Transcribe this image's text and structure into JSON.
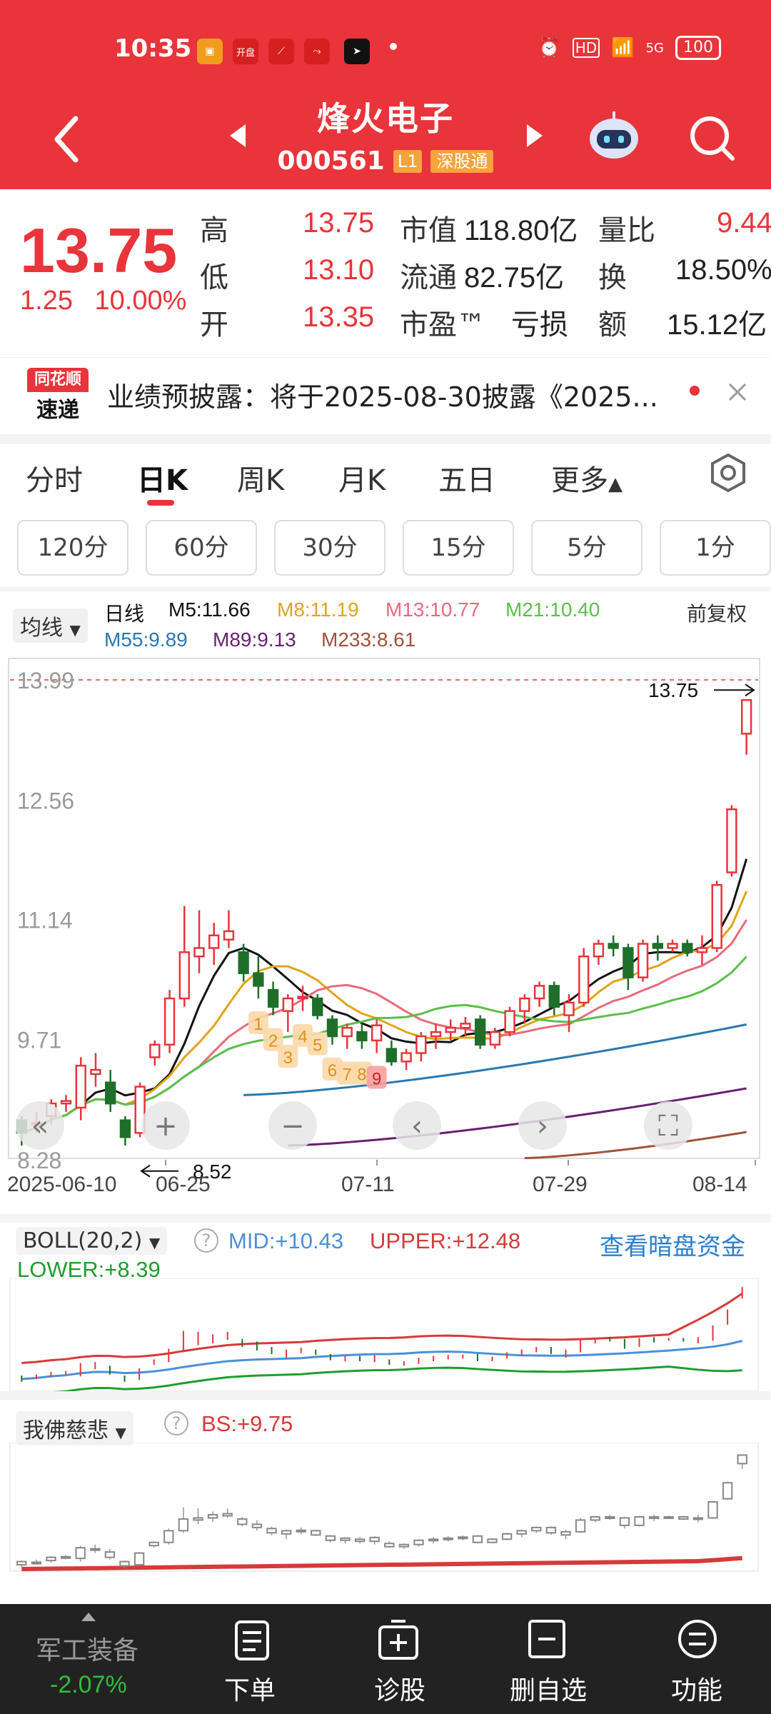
{
  "status_bar": {
    "time": "10:35",
    "net": "HD",
    "signal": "5G",
    "battery": "100"
  },
  "status_apps": [
    "开盘"
  ],
  "header": {
    "title": "烽火电子",
    "code": "000561",
    "level_tag": "L1",
    "market_tag": "深股通"
  },
  "quote": {
    "price": "13.75",
    "change": "1.25",
    "change_pct": "10.00%",
    "rows": [
      {
        "l1": "高",
        "v1": "13.75",
        "l2": "市值",
        "v2": "118.80亿",
        "l3": "量比",
        "v3": "9.44"
      },
      {
        "l1": "低",
        "v1": "13.10",
        "l2": "流通",
        "v2": "82.75亿",
        "l3": "换",
        "v3": "18.50%"
      },
      {
        "l1": "开",
        "v1": "13.35",
        "l2": "市盈™",
        "v2": "亏损",
        "l3": "额",
        "v3": "15.12亿"
      }
    ]
  },
  "news": {
    "logo_top": "同花顺",
    "logo_bottom": "速递",
    "text": "业绩预披露：将于2025-08-30披露《2025..."
  },
  "chart_tabs": [
    "分时",
    "日K",
    "周K",
    "月K",
    "五日",
    "更多"
  ],
  "active_tab": "日K",
  "minute_buttons": [
    "120分",
    "60分",
    "30分",
    "15分",
    "5分",
    "1分"
  ],
  "ma_legend": {
    "dropdown": "均线",
    "period": "日线",
    "right": "前复权",
    "items": [
      {
        "label": "M5:11.66",
        "color": "#111111"
      },
      {
        "label": "M8:11.19",
        "color": "#E0A41A"
      },
      {
        "label": "M13:10.77",
        "color": "#E96A7C"
      },
      {
        "label": "M21:10.40",
        "color": "#5BBF4A"
      },
      {
        "label": "M55:9.89",
        "color": "#2A78B0"
      },
      {
        "label": "M89:9.13",
        "color": "#6A1F6E"
      },
      {
        "label": "M233:8.61",
        "color": "#A0523C"
      }
    ]
  },
  "main_chart": {
    "y_ticks": [
      "13.99",
      "12.56",
      "11.14",
      "9.71",
      "8.28"
    ],
    "x_ticks": [
      "2025-06-10",
      "06-25",
      "07-11",
      "07-29",
      "08-14"
    ],
    "high_marker": "13.75",
    "low_marker": "8.52",
    "markers": [
      "1",
      "2",
      "3",
      "4",
      "5",
      "6",
      "7",
      "8",
      "9"
    ]
  },
  "chart_data": {
    "type": "candlestick",
    "x_range": [
      "2025-06-10",
      "2025-08-14"
    ],
    "ylim": [
      8.28,
      13.99
    ],
    "high": 13.75,
    "low": 8.52,
    "candles": [
      {
        "o": 8.75,
        "h": 8.8,
        "l": 8.45,
        "c": 8.6
      },
      {
        "o": 8.7,
        "h": 8.85,
        "l": 8.6,
        "c": 8.72
      },
      {
        "o": 8.8,
        "h": 9.0,
        "l": 8.7,
        "c": 8.95
      },
      {
        "o": 8.95,
        "h": 9.05,
        "l": 8.85,
        "c": 8.98
      },
      {
        "o": 8.9,
        "h": 9.5,
        "l": 8.75,
        "c": 9.4
      },
      {
        "o": 9.3,
        "h": 9.55,
        "l": 9.15,
        "c": 9.35
      },
      {
        "o": 9.2,
        "h": 9.35,
        "l": 8.85,
        "c": 8.95
      },
      {
        "o": 8.75,
        "h": 8.8,
        "l": 8.45,
        "c": 8.55
      },
      {
        "o": 8.6,
        "h": 9.2,
        "l": 8.55,
        "c": 9.15
      },
      {
        "o": 9.5,
        "h": 9.7,
        "l": 9.4,
        "c": 9.65
      },
      {
        "o": 9.65,
        "h": 10.3,
        "l": 9.55,
        "c": 10.2
      },
      {
        "o": 10.2,
        "h": 11.3,
        "l": 10.1,
        "c": 10.75
      },
      {
        "o": 10.7,
        "h": 11.25,
        "l": 10.5,
        "c": 10.8
      },
      {
        "o": 10.8,
        "h": 11.1,
        "l": 10.6,
        "c": 10.95
      },
      {
        "o": 10.9,
        "h": 11.25,
        "l": 10.8,
        "c": 11.0
      },
      {
        "o": 10.75,
        "h": 10.85,
        "l": 10.4,
        "c": 10.5
      },
      {
        "o": 10.5,
        "h": 10.7,
        "l": 10.2,
        "c": 10.35
      },
      {
        "o": 10.3,
        "h": 10.4,
        "l": 10.0,
        "c": 10.1
      },
      {
        "o": 10.05,
        "h": 10.25,
        "l": 9.8,
        "c": 10.2
      },
      {
        "o": 10.2,
        "h": 10.35,
        "l": 10.05,
        "c": 10.22
      },
      {
        "o": 10.2,
        "h": 10.25,
        "l": 9.95,
        "c": 10.0
      },
      {
        "o": 9.95,
        "h": 10.0,
        "l": 9.65,
        "c": 9.75
      },
      {
        "o": 9.75,
        "h": 9.9,
        "l": 9.6,
        "c": 9.85
      },
      {
        "o": 9.8,
        "h": 9.9,
        "l": 9.6,
        "c": 9.7
      },
      {
        "o": 9.7,
        "h": 9.95,
        "l": 9.55,
        "c": 9.88
      },
      {
        "o": 9.6,
        "h": 9.7,
        "l": 9.4,
        "c": 9.45
      },
      {
        "o": 9.45,
        "h": 9.6,
        "l": 9.35,
        "c": 9.55
      },
      {
        "o": 9.55,
        "h": 9.8,
        "l": 9.45,
        "c": 9.75
      },
      {
        "o": 9.75,
        "h": 9.9,
        "l": 9.6,
        "c": 9.8
      },
      {
        "o": 9.8,
        "h": 9.95,
        "l": 9.7,
        "c": 9.85
      },
      {
        "o": 9.85,
        "h": 9.98,
        "l": 9.75,
        "c": 9.9
      },
      {
        "o": 9.95,
        "h": 10.0,
        "l": 9.6,
        "c": 9.65
      },
      {
        "o": 9.65,
        "h": 9.85,
        "l": 9.6,
        "c": 9.8
      },
      {
        "o": 9.8,
        "h": 10.1,
        "l": 9.75,
        "c": 10.05
      },
      {
        "o": 10.05,
        "h": 10.25,
        "l": 9.9,
        "c": 10.2
      },
      {
        "o": 10.2,
        "h": 10.4,
        "l": 10.1,
        "c": 10.35
      },
      {
        "o": 10.35,
        "h": 10.4,
        "l": 10.0,
        "c": 10.1
      },
      {
        "o": 10.0,
        "h": 10.25,
        "l": 9.8,
        "c": 10.15
      },
      {
        "o": 10.15,
        "h": 10.8,
        "l": 10.1,
        "c": 10.7
      },
      {
        "o": 10.7,
        "h": 10.9,
        "l": 10.6,
        "c": 10.85
      },
      {
        "o": 10.85,
        "h": 10.95,
        "l": 10.7,
        "c": 10.8
      },
      {
        "o": 10.8,
        "h": 10.85,
        "l": 10.3,
        "c": 10.45
      },
      {
        "o": 10.45,
        "h": 10.9,
        "l": 10.4,
        "c": 10.85
      },
      {
        "o": 10.85,
        "h": 10.95,
        "l": 10.65,
        "c": 10.8
      },
      {
        "o": 10.8,
        "h": 10.9,
        "l": 10.75,
        "c": 10.85
      },
      {
        "o": 10.85,
        "h": 10.9,
        "l": 10.7,
        "c": 10.75
      },
      {
        "o": 10.75,
        "h": 10.95,
        "l": 10.6,
        "c": 10.8
      },
      {
        "o": 10.8,
        "h": 11.6,
        "l": 10.75,
        "c": 11.55
      },
      {
        "o": 11.7,
        "h": 12.5,
        "l": 11.65,
        "c": 12.45
      },
      {
        "o": 13.35,
        "h": 13.75,
        "l": 13.1,
        "c": 13.75
      }
    ]
  },
  "boll": {
    "dropdown": "BOLL(20,2)",
    "mid": "MID:+10.43",
    "upper": "UPPER:+12.48",
    "lower": "LOWER:+8.39",
    "link": "查看暗盘资金"
  },
  "indicator": {
    "dropdown": "我佛慈悲",
    "bs": "BS:+9.75"
  },
  "bottom_bar": {
    "sector": "军工装备",
    "sector_change": "-2.07%",
    "items": [
      "下单",
      "诊股",
      "删自选",
      "功能"
    ]
  }
}
